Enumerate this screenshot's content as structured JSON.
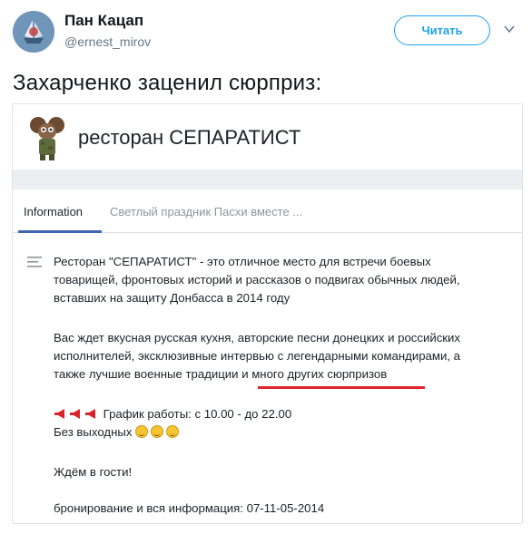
{
  "tweet": {
    "display_name": "Пан Кацап",
    "handle": "@ernest_mirov",
    "follow_label": "Читать",
    "text": "Захарченко заценил сюрприз:"
  },
  "embedded_page": {
    "page_name": "ресторан СЕПАРАТИСТ",
    "tabs": [
      {
        "label": "Information",
        "active": true
      },
      {
        "label": "Светлый праздник Пасхи вместе ..."
      }
    ],
    "description": {
      "p1_lines": [
        "Ресторан \"СЕПАРАТИСТ\" - это отличное место для встречи боевых",
        "товарищей, фронтовых историй и рассказов о подвигах обычных людей,",
        "вставших на защиту Донбасса в 2014 году"
      ],
      "p2_lines": [
        "Вас ждет вкусная русская кухня, авторские песни донецких и российских",
        "исполнителей, эксклюзивные интервью с легендарными командирами, а",
        "также лучшие военные традиции и много других сюрпризов"
      ],
      "schedule": "График работы: с 10.00 - до 22.00",
      "no_days_off": "Без выходных",
      "welcome": "Ждём в гости!",
      "booking": "бронирование и вся информация: 07-11-05-2014"
    }
  },
  "icons": [
    "avatar-logo",
    "chevron-down-icon",
    "soldier-page-picture",
    "lines-icon",
    "megaphone-icon",
    "grinning-emoji-icon"
  ],
  "colors": {
    "twitter_blue": "#1da1f2",
    "fb_blue": "#4267b2",
    "underline_red": "#e0242c"
  }
}
